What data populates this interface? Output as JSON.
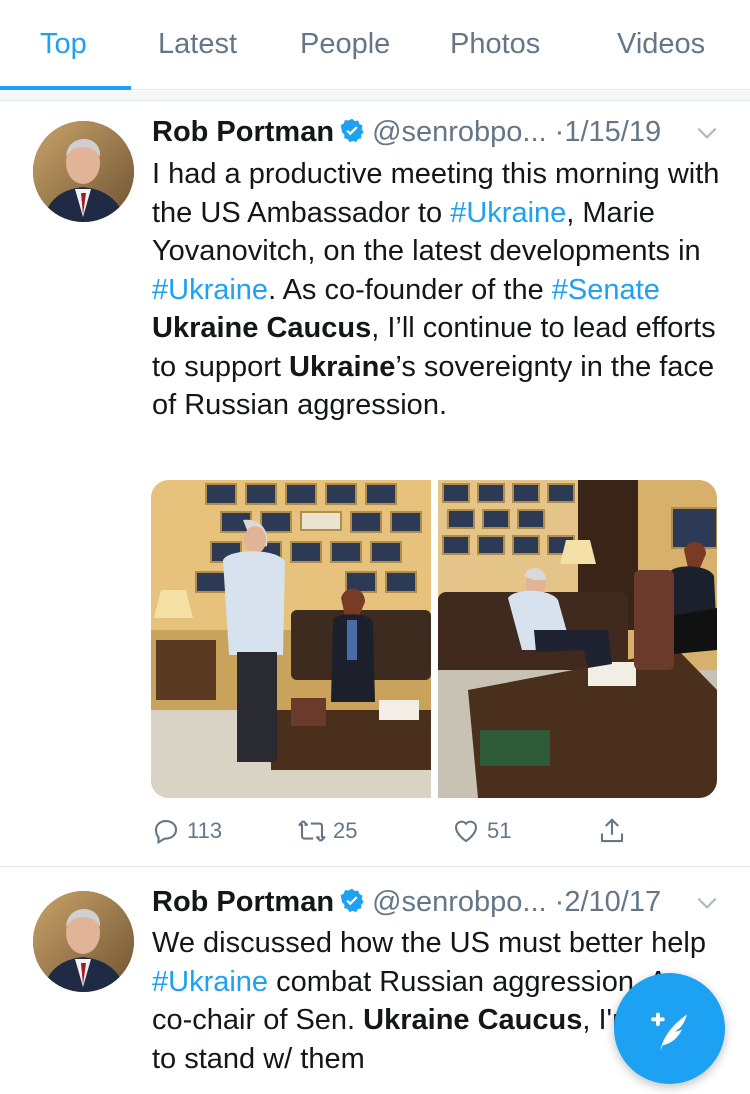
{
  "tabs": [
    {
      "label": "Top",
      "active": true
    },
    {
      "label": "Latest",
      "active": false
    },
    {
      "label": "People",
      "active": false
    },
    {
      "label": "Photos",
      "active": false
    },
    {
      "label": "Videos",
      "active": false
    }
  ],
  "colors": {
    "accent": "#1da1f2",
    "text": "#14171a",
    "secondary": "#657786",
    "divider": "#e1e8ed"
  },
  "tweets": [
    {
      "name": "Rob Portman",
      "verified": true,
      "handle": "@senrobpo...",
      "separator": "·",
      "date": "1/15/19",
      "text": {
        "t1": "I had a productive meeting this morning with the US Ambassador to ",
        "h1": "#Ukraine",
        "t2": ", Marie Yovanovitch, on the latest developments in ",
        "h2": "#Ukraine",
        "t3": ". As co-founder of the ",
        "h3": "#Senate",
        "t4": " ",
        "b1": "Ukraine Caucus",
        "t5": ", I’ll continue to lead efforts to support ",
        "b2": "Ukraine",
        "t6": "’s sovereignty in the face of Russian aggression."
      },
      "media_count": 2,
      "actions": {
        "replies": "113",
        "retweets": "25",
        "likes": "51"
      }
    },
    {
      "name": "Rob Portman",
      "verified": true,
      "handle": "@senrobpo...",
      "separator": "·",
      "date": "2/10/17",
      "text": {
        "t1": "We discussed how the US must better help ",
        "h1": "#Ukraine",
        "t2": " combat Russian aggression. As co-chair of Sen. ",
        "b1": "Ukraine Caucus",
        "t3": ", I'm proud to stand w/ them"
      }
    }
  ],
  "icons": {
    "verified": "verified-badge-icon",
    "caret": "chevron-down-icon",
    "reply": "reply-icon",
    "retweet": "retweet-icon",
    "like": "heart-icon",
    "share": "share-icon",
    "compose": "compose-tweet-icon"
  }
}
